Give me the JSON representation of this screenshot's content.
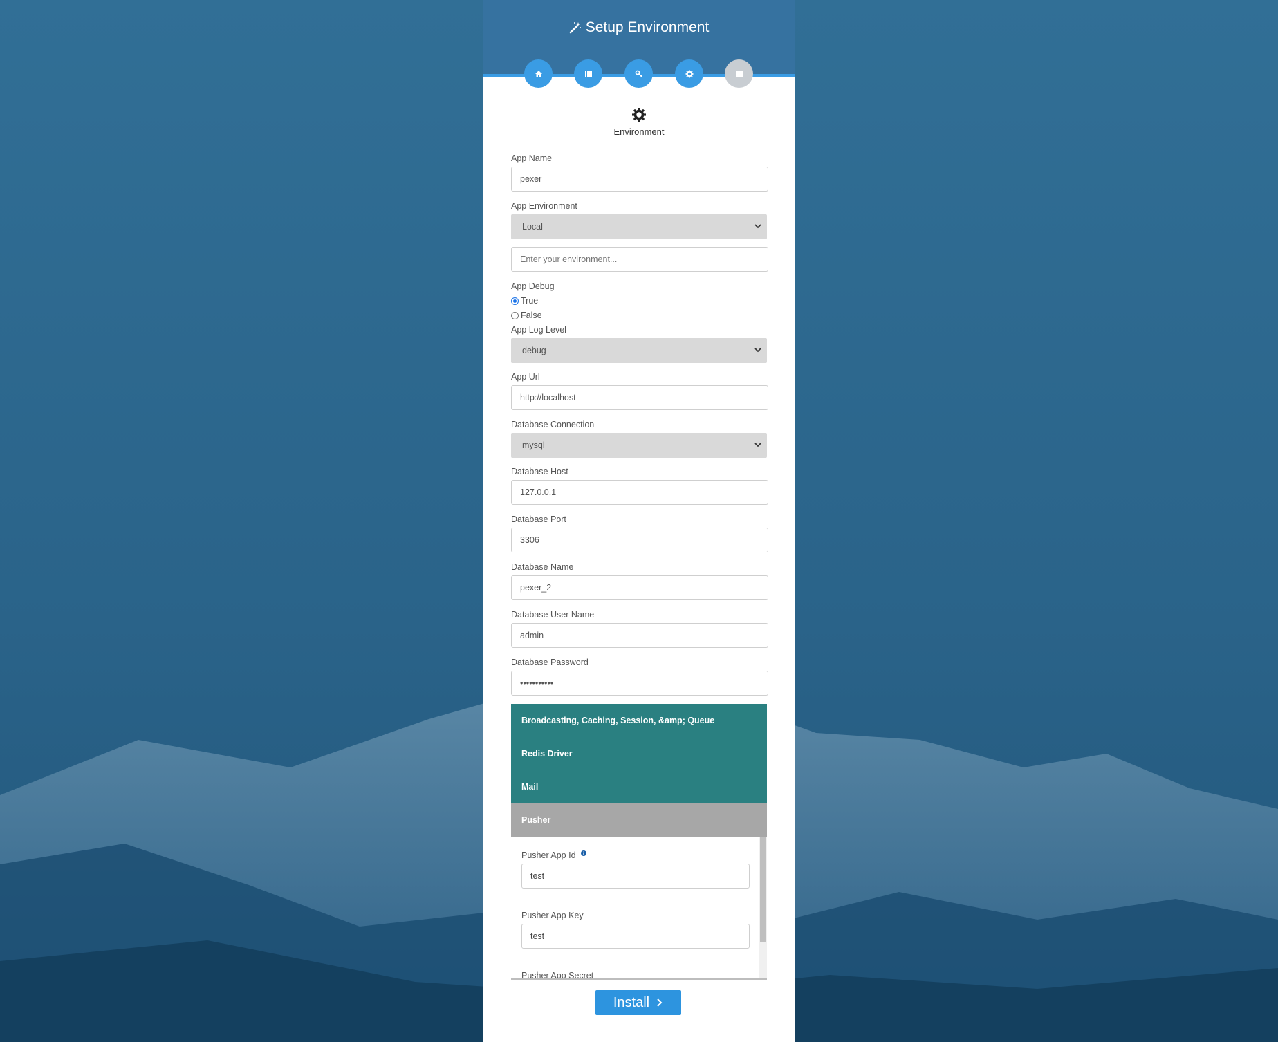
{
  "page": {
    "title": "Setup Environment",
    "section_title": "Environment"
  },
  "steps": [
    {
      "icon": "home-icon",
      "state": "complete"
    },
    {
      "icon": "list-icon",
      "state": "complete"
    },
    {
      "icon": "key-icon",
      "state": "complete"
    },
    {
      "icon": "gear-icon",
      "state": "current"
    },
    {
      "icon": "server-icon",
      "state": "pending"
    }
  ],
  "form": {
    "app_name": {
      "label": "App Name",
      "value": "pexer"
    },
    "app_environment": {
      "label": "App Environment",
      "selected": "Local",
      "custom_placeholder": "Enter your environment..."
    },
    "app_debug": {
      "label": "App Debug",
      "options": [
        "True",
        "False"
      ],
      "selected": "True"
    },
    "app_log_level": {
      "label": "App Log Level",
      "selected": "debug"
    },
    "app_url": {
      "label": "App Url",
      "value": "http://localhost"
    },
    "db_connection": {
      "label": "Database Connection",
      "selected": "mysql"
    },
    "db_host": {
      "label": "Database Host",
      "value": "127.0.0.1"
    },
    "db_port": {
      "label": "Database Port",
      "value": "3306"
    },
    "db_name": {
      "label": "Database Name",
      "value": "pexer_2"
    },
    "db_user": {
      "label": "Database User Name",
      "value": "admin"
    },
    "db_password": {
      "label": "Database Password",
      "value": "•••••••••••"
    }
  },
  "accordion": {
    "items": [
      {
        "label": "Broadcasting, Caching, Session, &amp; Queue"
      },
      {
        "label": "Redis Driver"
      },
      {
        "label": "Mail"
      },
      {
        "label": "Pusher"
      }
    ],
    "active": "Pusher",
    "pusher": {
      "app_id": {
        "label": "Pusher App Id",
        "value": "test"
      },
      "app_key": {
        "label": "Pusher App Key",
        "value": "test"
      },
      "app_secret": {
        "label": "Pusher App Secret"
      }
    }
  },
  "install_button": {
    "label": "Install"
  },
  "colors": {
    "header": "#3672a0",
    "step_active": "#3a9ce4",
    "step_inactive": "#c8cdd2",
    "accordion": "#2a8081",
    "accordion_active": "#a7a7a7",
    "button": "#2d94df"
  }
}
